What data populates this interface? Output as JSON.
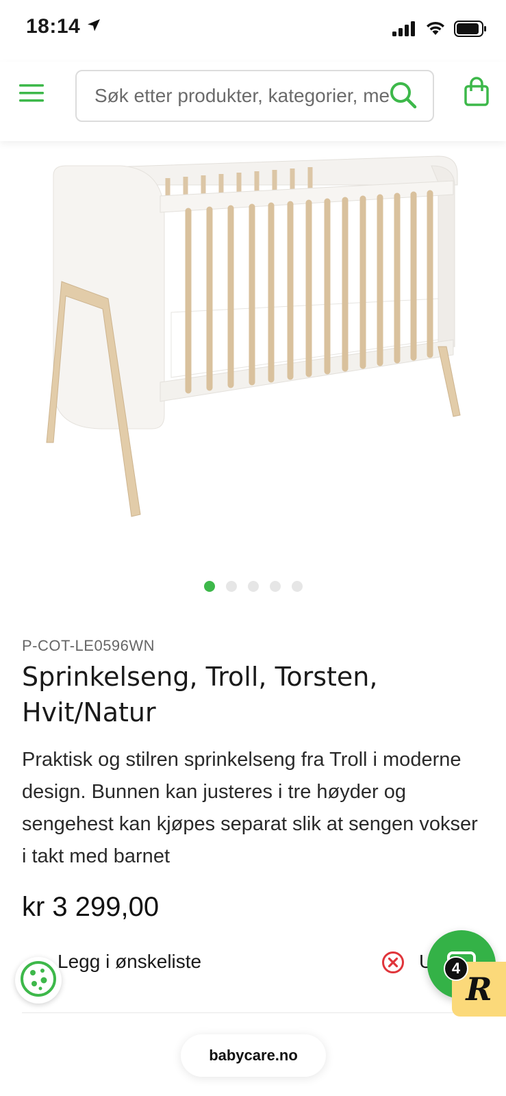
{
  "status_bar": {
    "time": "18:14",
    "icons": [
      "location-arrow-icon",
      "cellular-signal-icon",
      "wifi-icon",
      "battery-icon"
    ]
  },
  "header": {
    "menu_icon": "hamburger-menu-icon",
    "search": {
      "placeholder": "Søk etter produkter, kategorier, merker",
      "value": ""
    },
    "search_icon": "search-icon",
    "cart_icon": "shopping-bag-icon",
    "accent_color": "#3db84a"
  },
  "gallery": {
    "image_alt": "Sprinkelseng, Troll, Torsten, Hvit/Natur",
    "dots_total": 5,
    "active_dot": 1
  },
  "product": {
    "sku": "P-COT-LE0596WN",
    "title": "Sprinkelseng, Troll, Torsten, Hvit/Natur",
    "description": "Praktisk og stilren sprinkelseng fra Troll i moderne design. Bunnen kan justeres i tre høyder og sengehest kan kjøpes separat slik at sengen vokser i takt med barnet",
    "price": "kr 3 299,00"
  },
  "actions": {
    "wishlist_label": "Legg i ønskeliste",
    "remove_icon": "close-circle-icon",
    "partial_label": "U"
  },
  "browser": {
    "url": "babycare.no"
  },
  "floating": {
    "cookie_icon": "cookie-icon",
    "chat_icon": "chat-icon",
    "reward_letter": "R",
    "reward_count": "4"
  }
}
